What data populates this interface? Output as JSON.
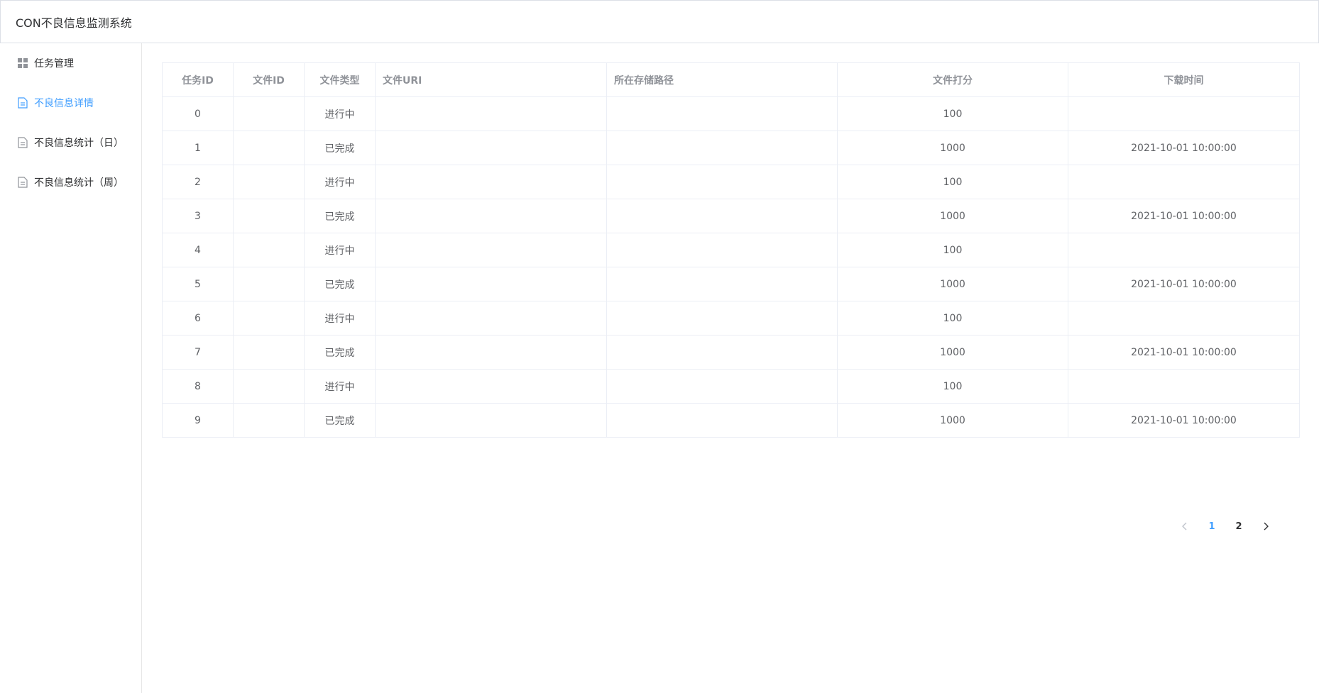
{
  "header": {
    "title": "CON不良信息监测系统"
  },
  "sidebar": {
    "items": [
      {
        "label": "任务管理",
        "icon": "grid-icon",
        "active": false
      },
      {
        "label": "不良信息详情",
        "icon": "document-icon",
        "active": true
      },
      {
        "label": "不良信息统计（日）",
        "icon": "document-icon",
        "active": false
      },
      {
        "label": "不良信息统计（周）",
        "icon": "document-icon",
        "active": false
      }
    ]
  },
  "table": {
    "columns": [
      "任务ID",
      "文件ID",
      "文件类型",
      "文件URI",
      "所在存储路径",
      "文件打分",
      "下载时间"
    ],
    "rows": [
      [
        "0",
        "",
        "进行中",
        "",
        "",
        "100",
        ""
      ],
      [
        "1",
        "",
        "已完成",
        "",
        "",
        "1000",
        "2021-10-01 10:00:00"
      ],
      [
        "2",
        "",
        "进行中",
        "",
        "",
        "100",
        ""
      ],
      [
        "3",
        "",
        "已完成",
        "",
        "",
        "1000",
        "2021-10-01 10:00:00"
      ],
      [
        "4",
        "",
        "进行中",
        "",
        "",
        "100",
        ""
      ],
      [
        "5",
        "",
        "已完成",
        "",
        "",
        "1000",
        "2021-10-01 10:00:00"
      ],
      [
        "6",
        "",
        "进行中",
        "",
        "",
        "100",
        ""
      ],
      [
        "7",
        "",
        "已完成",
        "",
        "",
        "1000",
        "2021-10-01 10:00:00"
      ],
      [
        "8",
        "",
        "进行中",
        "",
        "",
        "100",
        ""
      ],
      [
        "9",
        "",
        "已完成",
        "",
        "",
        "1000",
        "2021-10-01 10:00:00"
      ]
    ]
  },
  "pagination": {
    "prev_icon": "chevron-left-icon",
    "next_icon": "chevron-right-icon",
    "pages": [
      "1",
      "2"
    ],
    "current": "1"
  },
  "colors": {
    "accent": "#409eff",
    "border": "#ebeef5",
    "text": "#606266",
    "header_text": "#909399"
  }
}
